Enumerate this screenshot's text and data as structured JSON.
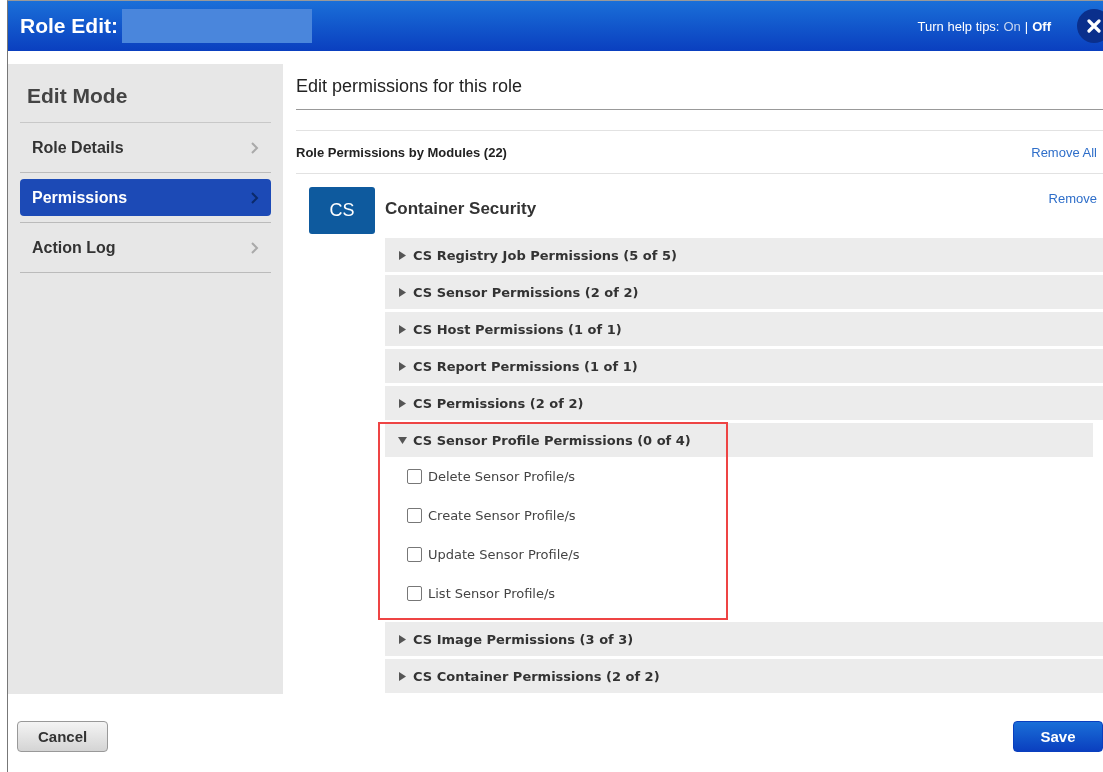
{
  "window": {
    "title": "Role Edit:",
    "title_redacted": true,
    "help_tips": {
      "label": "Turn help tips:",
      "separator": "|",
      "options": [
        {
          "label": "On",
          "selected": false
        },
        {
          "label": "Off",
          "selected": true
        }
      ]
    }
  },
  "sidebar": {
    "heading": "Edit Mode",
    "items": [
      {
        "label": "Role Details",
        "selected": false
      },
      {
        "label": "Permissions",
        "selected": true
      },
      {
        "label": "Action Log",
        "selected": false
      }
    ]
  },
  "content": {
    "title": "Edit permissions for this role",
    "modules_header": {
      "label": "Role Permissions by Modules (22)",
      "action": "Remove All"
    },
    "module": {
      "badge": "CS",
      "name": "Container Security",
      "action": "Remove",
      "groups": [
        {
          "label": "CS Registry Job Permissions (5 of 5)",
          "expanded": false,
          "highlighted": false
        },
        {
          "label": "CS Sensor Permissions (2 of 2)",
          "expanded": false,
          "highlighted": false
        },
        {
          "label": "CS Host Permissions (1 of 1)",
          "expanded": false,
          "highlighted": false
        },
        {
          "label": "CS Report Permissions (1 of 1)",
          "expanded": false,
          "highlighted": false
        },
        {
          "label": "CS Permissions (2 of 2)",
          "expanded": false,
          "highlighted": false
        },
        {
          "label": "CS Sensor Profile Permissions (0 of 4)",
          "expanded": true,
          "highlighted": true,
          "items": [
            {
              "label": "Delete Sensor Profile/s",
              "checked": false
            },
            {
              "label": "Create Sensor Profile/s",
              "checked": false
            },
            {
              "label": "Update Sensor Profile/s",
              "checked": false
            },
            {
              "label": "List Sensor Profile/s",
              "checked": false
            }
          ]
        },
        {
          "label": "CS Image Permissions (3 of 3)",
          "expanded": false,
          "highlighted": false
        },
        {
          "label": "CS Container Permissions (2 of 2)",
          "expanded": false,
          "highlighted": false
        }
      ]
    }
  },
  "footer": {
    "buttons": [
      {
        "label": "Cancel",
        "kind": "secondary"
      },
      {
        "label": "Save",
        "kind": "primary"
      }
    ]
  }
}
